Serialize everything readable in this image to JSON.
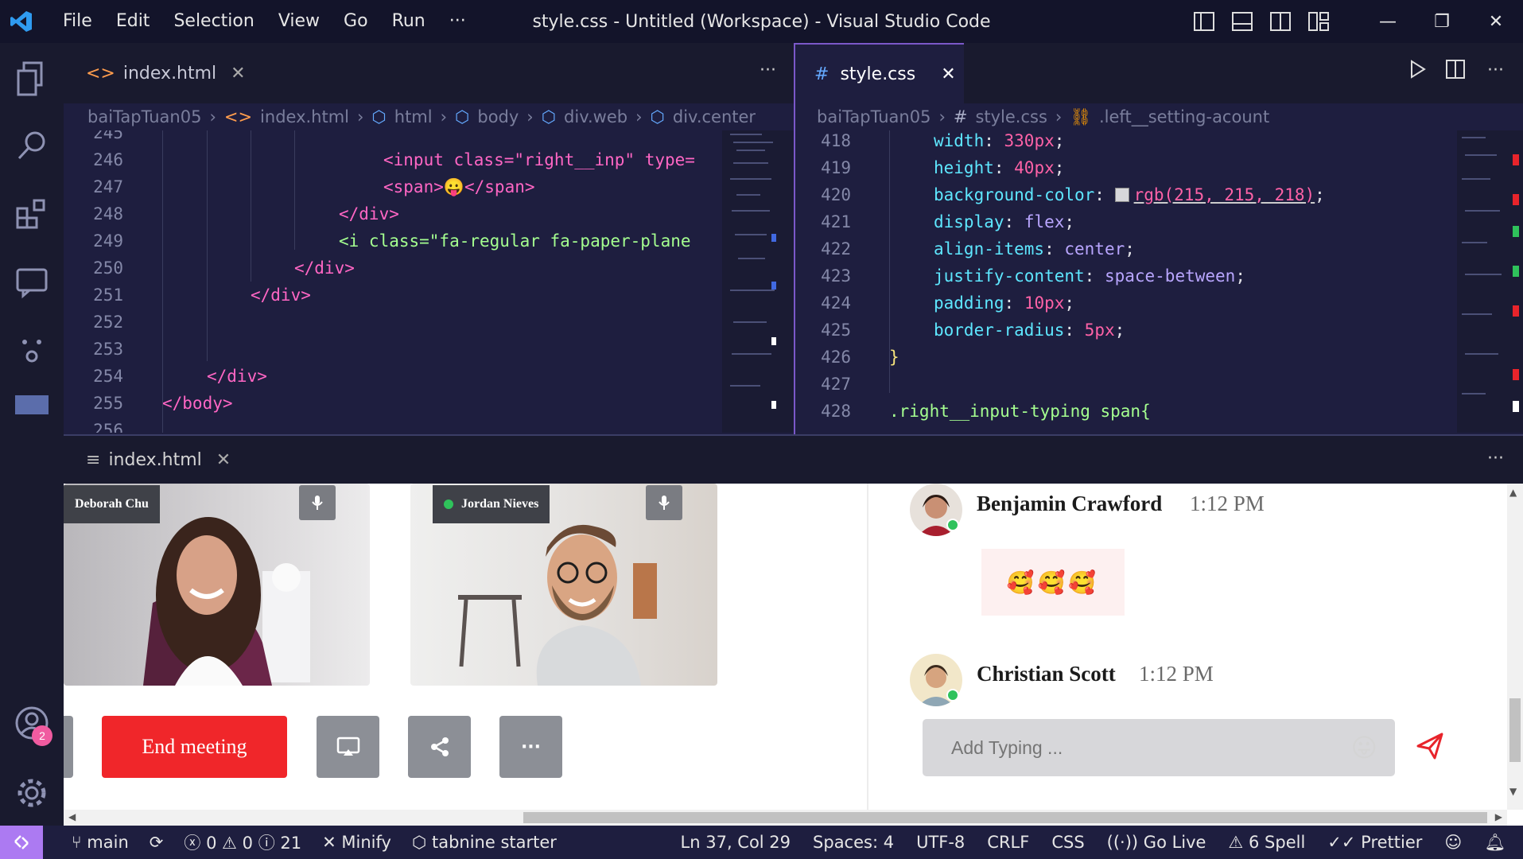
{
  "titlebar": {
    "menu": [
      "File",
      "Edit",
      "Selection",
      "View",
      "Go",
      "Run",
      "···"
    ],
    "title": "style.css - Untitled (Workspace) - Visual Studio Code"
  },
  "activity": {
    "accounts_badge": "2"
  },
  "left_editor": {
    "tab_label": "index.html",
    "breadcrumb": [
      "baiTapTuan05",
      "index.html",
      "html",
      "body",
      "div.web",
      "div.center"
    ],
    "lines": [
      {
        "n": "245",
        "t": ""
      },
      {
        "n": "246",
        "t": "<input class=\"right__inp\" type="
      },
      {
        "n": "247",
        "t": "<span>😛</span>"
      },
      {
        "n": "248",
        "t": "</div>"
      },
      {
        "n": "249",
        "t": "<i class=\"fa-regular fa-paper-plane"
      },
      {
        "n": "250",
        "t": "</div>"
      },
      {
        "n": "251",
        "t": "</div>"
      },
      {
        "n": "252",
        "t": ""
      },
      {
        "n": "253",
        "t": ""
      },
      {
        "n": "254",
        "t": "</div>"
      },
      {
        "n": "255",
        "t": "</body>"
      },
      {
        "n": "256",
        "t": ""
      }
    ]
  },
  "right_editor": {
    "tab_label": "style.css",
    "breadcrumb": [
      "baiTapTuan05",
      "style.css",
      ".left__setting-acount"
    ],
    "lines": [
      {
        "n": "418",
        "prop": "width",
        "val": "330px"
      },
      {
        "n": "419",
        "prop": "height",
        "val": "40px"
      },
      {
        "n": "420",
        "prop": "background-color",
        "val": "rgb(215, 215, 218)"
      },
      {
        "n": "421",
        "prop": "display",
        "val": "flex"
      },
      {
        "n": "422",
        "prop": "align-items",
        "val": "center"
      },
      {
        "n": "423",
        "prop": "justify-content",
        "val": "space-between"
      },
      {
        "n": "424",
        "prop": "padding",
        "val": "10px"
      },
      {
        "n": "425",
        "prop": "border-radius",
        "val": "5px"
      },
      {
        "n": "426",
        "raw": "}"
      },
      {
        "n": "427",
        "raw": ""
      },
      {
        "n": "428",
        "sel": ".right__input-typing span{"
      }
    ]
  },
  "panel": {
    "tab_label": "index.html",
    "videos": [
      {
        "name": "Deborah Chu"
      },
      {
        "name": "Jordan Nieves"
      }
    ],
    "end_meeting": "End meeting",
    "more_label": "···",
    "chat": [
      {
        "name": "Benjamin Crawford",
        "time": "1:12 PM",
        "message": "🥰🥰🥰"
      },
      {
        "name": "Christian Scott",
        "time": "1:12 PM"
      }
    ],
    "input_placeholder": "Add Typing ...",
    "emoji": "😛"
  },
  "statusbar": {
    "branch": "main",
    "errors": "0",
    "warnings": "0",
    "infos": "21",
    "minify": "Minify",
    "tabnine": "tabnine starter",
    "position": "Ln 37, Col 29",
    "spaces": "Spaces: 4",
    "encoding": "UTF-8",
    "eol": "CRLF",
    "language": "CSS",
    "golive": "Go Live",
    "spell": "6 Spell",
    "prettier": "Prettier"
  },
  "colors": {
    "accent": "#ac7af2",
    "end_meeting": "#f0262a",
    "send": "#e8242b",
    "online": "#2fc25b"
  }
}
